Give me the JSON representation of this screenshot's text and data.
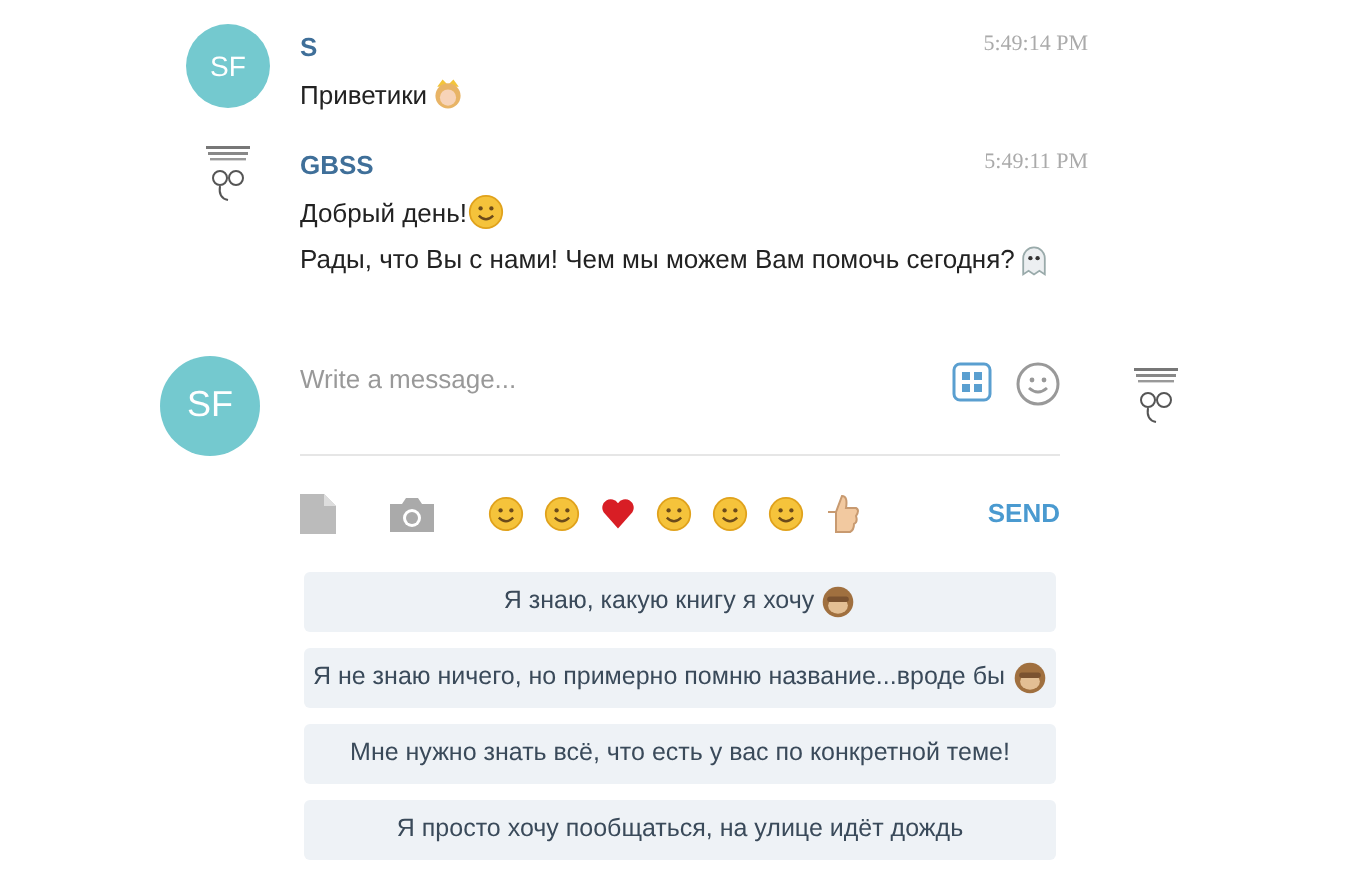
{
  "messages": [
    {
      "avatar": {
        "kind": "initials",
        "text": "SF"
      },
      "author": "S",
      "time": "5:49:14 PM",
      "lines": [
        "Приветики"
      ]
    },
    {
      "avatar": {
        "kind": "logo"
      },
      "author": "GBSS",
      "time": "5:49:11 PM",
      "lines": [
        "Добрый день!",
        "Рады, что Вы с нами! Чем мы можем Вам помочь сегодня?"
      ]
    }
  ],
  "composer": {
    "avatar": {
      "kind": "initials",
      "text": "SF"
    },
    "placeholder": "Write a message...",
    "send": "SEND"
  },
  "quick_replies": [
    "Я знаю, какую книгу я хочу",
    "Я не знаю ничего, но примерно помню название...вроде бы",
    "Мне нужно знать всё, что есть у вас по конкретной теме!",
    "Я просто хочу пообщаться, на улице идёт дождь"
  ]
}
